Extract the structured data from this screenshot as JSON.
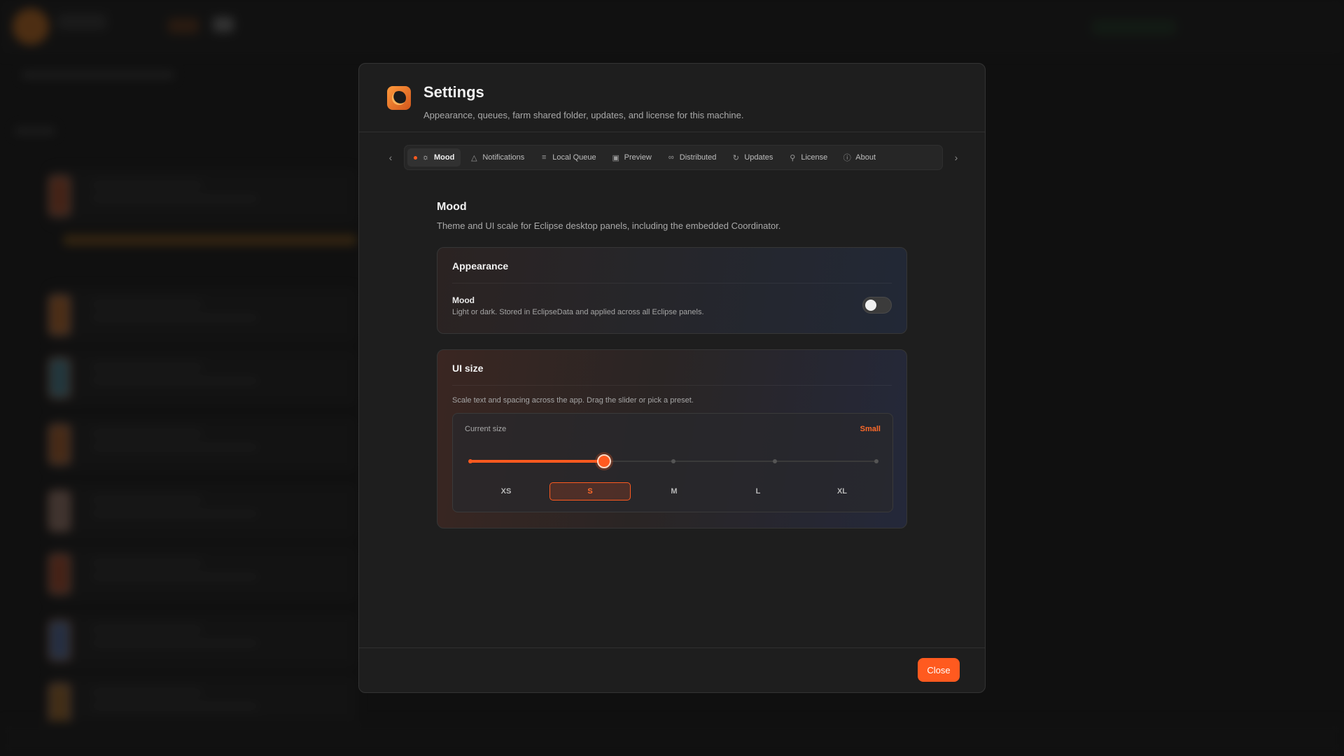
{
  "modal": {
    "title": "Settings",
    "subtitle": "Appearance, queues, farm shared folder, updates, and license for this machine.",
    "icon": "app-logo-icon"
  },
  "tabs": [
    {
      "label": "Mood",
      "icon": "sun-icon",
      "active": true
    },
    {
      "label": "Notifications",
      "icon": "bell-icon"
    },
    {
      "label": "Local Queue",
      "icon": "list-icon"
    },
    {
      "label": "Preview",
      "icon": "image-icon"
    },
    {
      "label": "Distributed",
      "icon": "link-icon"
    },
    {
      "label": "Updates",
      "icon": "refresh-icon"
    },
    {
      "label": "License",
      "icon": "key-icon"
    },
    {
      "label": "About",
      "icon": "info-icon"
    }
  ],
  "section": {
    "title": "Mood",
    "description": "Theme and UI scale for Eclipse desktop panels, including the embedded Coordinator."
  },
  "appearance": {
    "title": "Appearance",
    "mood_label": "Mood",
    "mood_description": "Light or dark. Stored in EclipseData and applied across all Eclipse panels.",
    "mood_toggle_on": false
  },
  "ui_size": {
    "title": "UI size",
    "description": "Scale text and spacing across the app. Drag the slider or pick a preset.",
    "current_label": "Current size",
    "current_value": "Small",
    "slider_fraction": 0.33,
    "presets": [
      "XS",
      "S",
      "M",
      "L",
      "XL"
    ],
    "selected_preset": "S"
  },
  "footer": {
    "close_label": "Close"
  },
  "colors": {
    "accent": "#ff5a1f",
    "background": "#1e1e1e"
  }
}
